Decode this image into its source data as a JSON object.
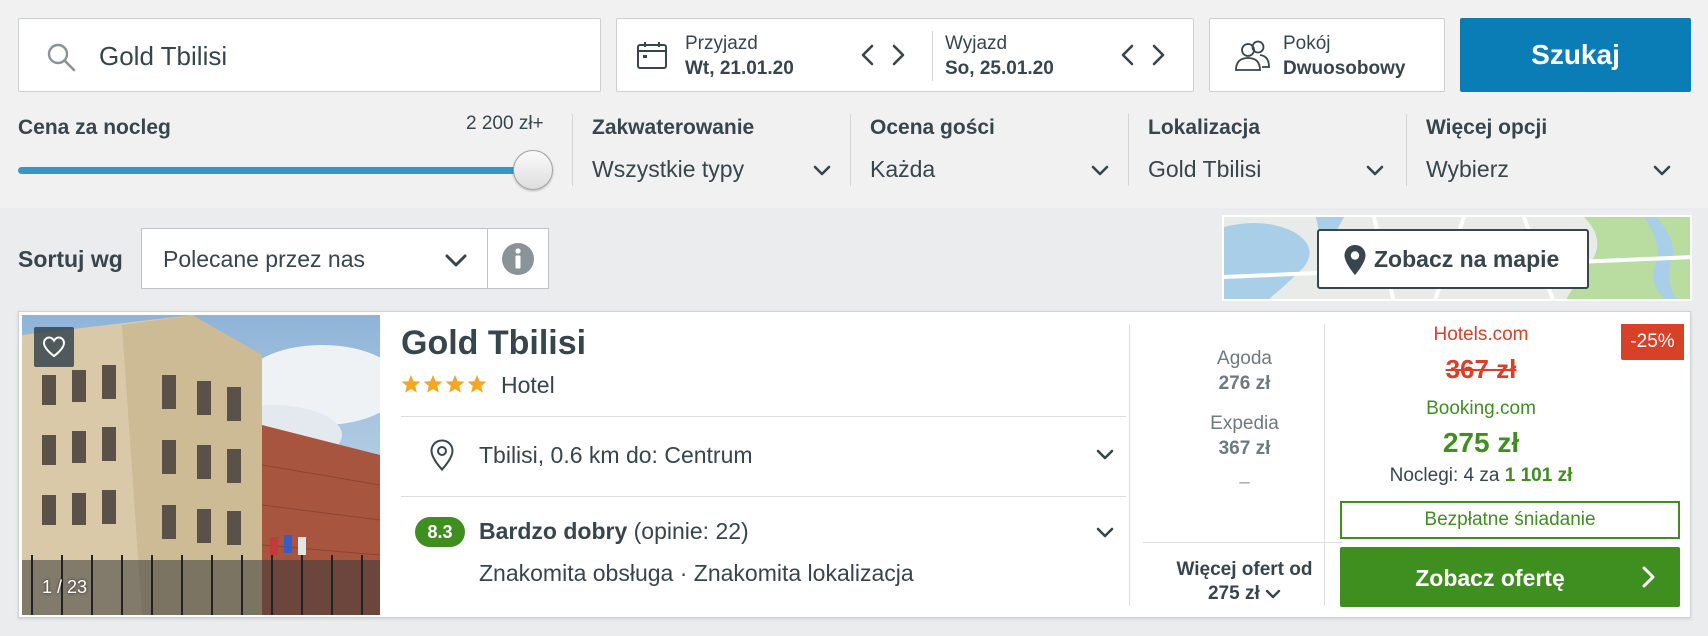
{
  "search": {
    "query": "Gold Tbilisi",
    "button_label": "Szukaj"
  },
  "dates": {
    "checkin_label": "Przyjazd",
    "checkin_value": "Wt, 21.01.20",
    "checkout_label": "Wyjazd",
    "checkout_value": "So, 25.01.20"
  },
  "room": {
    "label": "Pokój",
    "value": "Dwuosobowy"
  },
  "filters": {
    "price": {
      "title": "Cena za nocleg",
      "max_label": "2 200 zł+",
      "level_fraction": 1.0
    },
    "accommodation": {
      "title": "Zakwaterowanie",
      "value": "Wszystkie typy"
    },
    "rating": {
      "title": "Ocena gości",
      "value": "Każda"
    },
    "location": {
      "title": "Lokalizacja",
      "value": "Gold Tbilisi"
    },
    "more": {
      "title": "Więcej opcji",
      "value": "Wybierz"
    }
  },
  "sort": {
    "label": "Sortuj wg",
    "value": "Polecane przez nas"
  },
  "map": {
    "button_label": "Zobacz na mapie"
  },
  "hotel": {
    "name": "Gold Tbilisi",
    "stars": 4,
    "type": "Hotel",
    "image_counter": "1 / 23",
    "location": "Tbilisi, 0.6 km do: Centrum",
    "rating_score": "8.3",
    "rating_label": "Bardzo dobry",
    "rating_reviews": "(opinie: 22)",
    "tags": "Znakomita obsługa · Znakomita lokalizacja",
    "other_offers": [
      {
        "provider": "Agoda",
        "price": "276 zł"
      },
      {
        "provider": "Expedia",
        "price": "367 zł"
      }
    ],
    "other_dash": "–",
    "more_offers_line1": "Więcej ofert od",
    "more_offers_line2": "275 zł",
    "deal": {
      "discount": "-25%",
      "compare_provider": "Hotels.com",
      "compare_price": "367 zł",
      "provider": "Booking.com",
      "price": "275 zł",
      "nights_text": "Noclegi: 4 za",
      "nights_total": "1 101 zł",
      "perk": "Bezpłatne śniadanie",
      "cta": "Zobacz ofertę"
    }
  },
  "colors": {
    "brand_blue": "#0a7db6",
    "deal_green": "#3f8f20",
    "discount_red": "#d64128",
    "text": "#37454d"
  }
}
